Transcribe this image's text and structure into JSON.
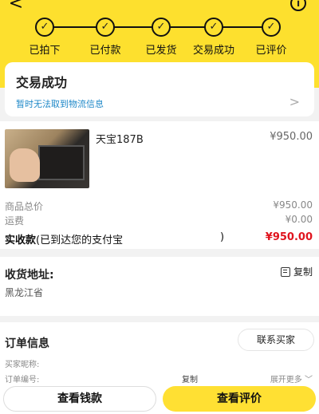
{
  "header": {
    "back_icon": "back-arrow-icon",
    "info_icon": "info-icon",
    "info_glyph": "i",
    "back_glyph": "<",
    "accent_color": "#fde02e",
    "steps": [
      {
        "label": "已拍下",
        "check": "✓"
      },
      {
        "label": "已付款",
        "check": "✓"
      },
      {
        "label": "已发货",
        "check": "✓"
      },
      {
        "label": "交易成功",
        "check": "✓"
      },
      {
        "label": "已评价",
        "check": "✓"
      }
    ]
  },
  "status": {
    "title": "交易成功",
    "logistics": "暂时无法取到物流信息",
    "arrow": ">"
  },
  "product": {
    "name": "天宝187B",
    "price": "¥950.00"
  },
  "prices": {
    "total_label": "商品总价",
    "total_value": "¥950.00",
    "shipping_label": "运费",
    "shipping_value": "¥0.00",
    "paid_label": "实收款",
    "paid_note": "(已到达您的支付宝",
    "paid_paren": ")",
    "paid_value": "¥950.00",
    "paid_color": "#e0141e"
  },
  "address": {
    "title": "收货地址:",
    "copy_label": "复制",
    "text": "黑龙江省"
  },
  "order_info": {
    "title": "订单信息",
    "contact_label": "联系买家",
    "buyer_nick_label": "买家昵称:",
    "order_no_label": "订单编号:",
    "copy_label": "复制",
    "expand_label": "展开更多",
    "expand_glyph": "﹀"
  },
  "bottom": {
    "view_money": "查看钱款",
    "view_review": "查看评价"
  }
}
